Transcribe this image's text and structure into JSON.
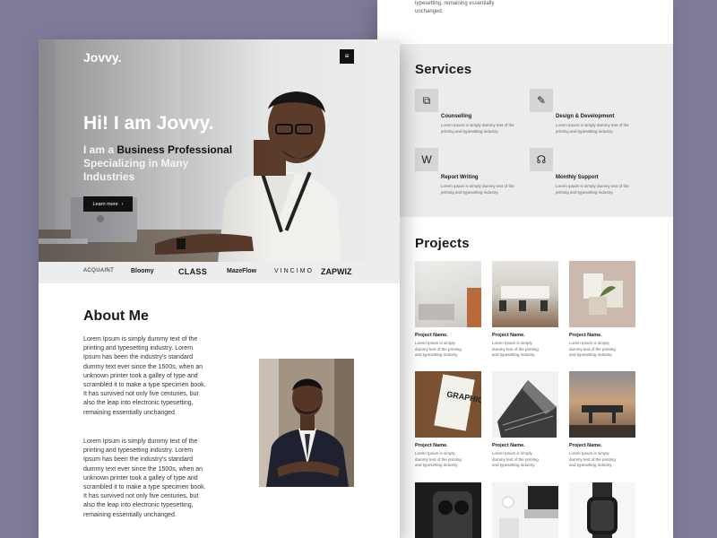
{
  "colors": {
    "background": "#7d7b98",
    "accent": "#111111",
    "services_bg": "#ececec"
  },
  "right_page": {
    "top_text": "typesetting, remaining essentially unchanged.",
    "services": {
      "title": "Services",
      "items": [
        {
          "icon": "network-icon",
          "title": "Counselling",
          "desc": "Lorem Ipsum is simply dummy text of the printing and typesetting industry."
        },
        {
          "icon": "design-tools-icon",
          "title": "Design & Development",
          "desc": "Lorem Ipsum is simply dummy text of the printing and typesetting industry."
        },
        {
          "icon": "word-doc-icon",
          "title": "Report Writing",
          "desc": "Lorem Ipsum is simply dummy text of the printing and typesetting industry."
        },
        {
          "icon": "headset-icon",
          "title": "Monthly Support",
          "desc": "Lorem Ipsum is simply dummy text of the printing and typesetting industry."
        }
      ]
    },
    "projects": {
      "title": "Projects",
      "items": [
        {
          "name": "Project Name.",
          "desc": "Lorem Ipsum is simply dummy text of the printing and typesetting industry."
        },
        {
          "name": "Project Name.",
          "desc": "Lorem Ipsum is simply dummy text of the printing and typesetting industry."
        },
        {
          "name": "Project Name.",
          "desc": "Lorem Ipsum is simply dummy text of the printing and typesetting industry."
        },
        {
          "name": "Project Name.",
          "desc": "Lorem Ipsum is simply dummy text of the printing and typesetting industry."
        },
        {
          "name": "Project Name.",
          "desc": "Lorem Ipsum is simply dummy text of the printing and typesetting industry."
        },
        {
          "name": "Project Name.",
          "desc": "Lorem Ipsum is simply dummy text of the printing and typesetting industry."
        }
      ]
    }
  },
  "left_page": {
    "logo": "Jovvy.",
    "menu_icon": "hamburger-icon",
    "hero": {
      "title": "Hi! I am Jovvy.",
      "sub_1": "I am a ",
      "sub_2": "Business Professional",
      "sub_3": " Specializing in Many Industries",
      "button": "Learn more",
      "button_icon": "chevron-right-icon"
    },
    "brands": [
      "ACQUAINT",
      "Bloomy",
      "CLASS",
      "MazeFlow",
      "VINCIMO",
      "ZAPWIZ"
    ],
    "about": {
      "title": "About Me",
      "p1": "Lorem Ipsum is simply dummy text of the printing and typesetting industry. Lorem Ipsum has been the industry's standard dummy text ever since the 1500s, when an unknown printer took a galley of type and scrambled it to make a type specimen book. It has survived not only five centuries, but also the leap into electronic typesetting, remaining essentially unchanged.",
      "p2": "Lorem Ipsum is simply dummy text of the printing and typesetting industry. Lorem Ipsum has been the industry's standard dummy text ever since the 1500s, when an unknown printer took a galley of type and scrambled it to make a type specimen book. It has survived not only five centuries, but also the leap into electronic typesetting, remaining essentially unchanged."
    }
  }
}
